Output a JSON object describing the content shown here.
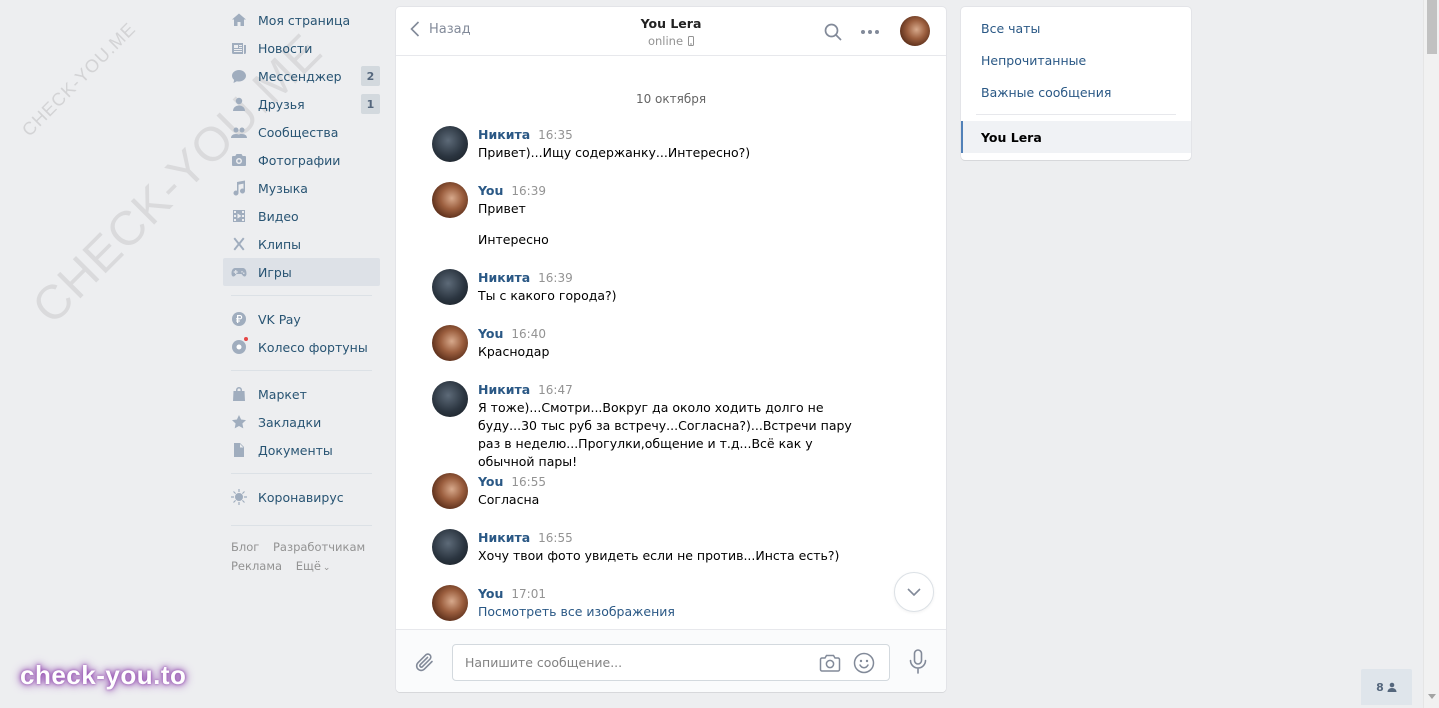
{
  "watermarks": {
    "small": "CHECK-YOU.ME",
    "big": "CHECK-YOU.ME",
    "brand": "check-you.to"
  },
  "nav": {
    "items": [
      {
        "label": "Моя страница",
        "icon": "home-icon"
      },
      {
        "label": "Новости",
        "icon": "news-icon"
      },
      {
        "label": "Мессенджер",
        "icon": "messenger-icon",
        "badge": "2"
      },
      {
        "label": "Друзья",
        "icon": "friends-icon",
        "badge": "1"
      },
      {
        "label": "Сообщества",
        "icon": "groups-icon"
      },
      {
        "label": "Фотографии",
        "icon": "camera-icon"
      },
      {
        "label": "Музыка",
        "icon": "music-icon"
      },
      {
        "label": "Видео",
        "icon": "video-icon"
      },
      {
        "label": "Клипы",
        "icon": "clips-icon"
      },
      {
        "label": "Игры",
        "icon": "games-icon",
        "active": true
      }
    ],
    "items2": [
      {
        "label": "VK Pay",
        "icon": "vkpay-icon"
      },
      {
        "label": "Колесо фортуны",
        "icon": "wheel-icon"
      }
    ],
    "items3": [
      {
        "label": "Маркет",
        "icon": "market-icon"
      },
      {
        "label": "Закладки",
        "icon": "bookmarks-icon"
      },
      {
        "label": "Документы",
        "icon": "documents-icon"
      }
    ],
    "items4": [
      {
        "label": "Коронавирус",
        "icon": "coronavirus-icon"
      }
    ],
    "footer": {
      "blog": "Блог",
      "developers": "Разработчикам",
      "ads": "Реклама",
      "more": "Ещё"
    }
  },
  "chat": {
    "back_label": "Назад",
    "peer_name": "You Lera",
    "peer_status": "online",
    "date_separator": "10 октября",
    "messages": [
      {
        "author": "Никита",
        "time": "16:35",
        "text": "Привет)...Ищу содержанку...Интересно?)"
      },
      {
        "author": "You",
        "time": "16:39",
        "text": "Привет",
        "text2": "Интересно"
      },
      {
        "author": "Никита",
        "time": "16:39",
        "text": "Ты с какого города?)"
      },
      {
        "author": "You",
        "time": "16:40",
        "text": "Краснодар"
      },
      {
        "author": "Никита",
        "time": "16:47",
        "text": "Я тоже)...Смотри...Вокруг да около ходить долго не буду...30 тыс руб за встречу...Согласна?)...Встречи пару раз в неделю...Прогулки,общение и т.д...Всё как у обычной пары!"
      },
      {
        "author": "You",
        "time": "16:55",
        "text": "Согласна"
      },
      {
        "author": "Никита",
        "time": "16:55",
        "text": "Хочу твои фото увидеть если не против...Инста есть?)"
      },
      {
        "author": "You",
        "time": "17:01",
        "text": "Посмотреть все изображения"
      }
    ],
    "composer_placeholder": "Напишите сообщение..."
  },
  "right_panel": {
    "items": [
      "Все чаты",
      "Непрочитанные",
      "Важные сообщения"
    ],
    "active_chat": "You Lera"
  },
  "online_count": "8"
}
